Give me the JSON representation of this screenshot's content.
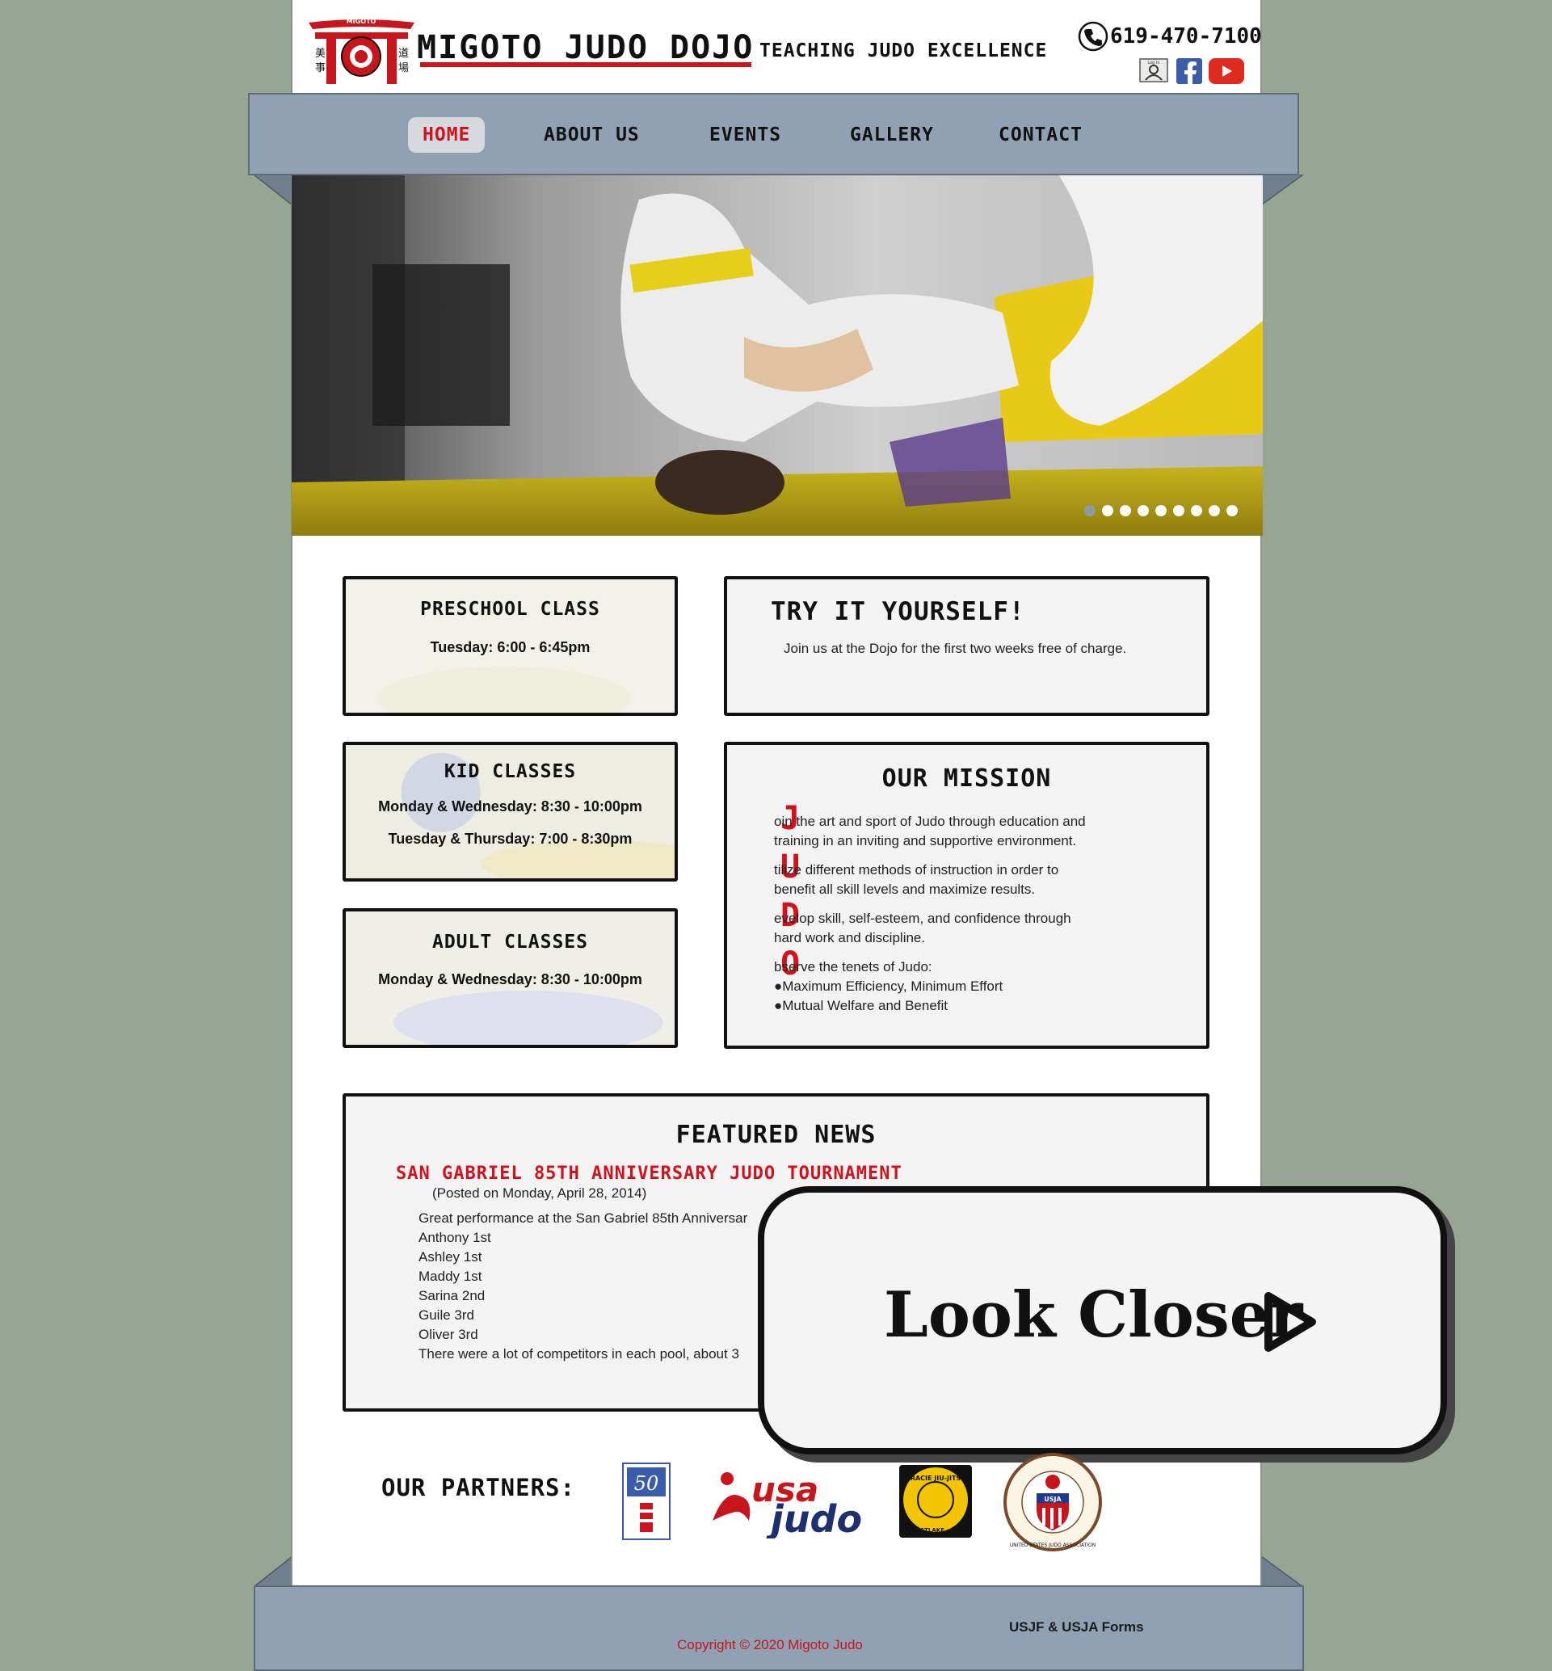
{
  "header": {
    "site_name": "Migoto Judo Dojo",
    "tagline": "Teaching Judo Excellence",
    "phone": "619-470-7100",
    "logo_text": "MIGOTO",
    "login_label": "Log In"
  },
  "nav": {
    "items": [
      {
        "label": "HOME",
        "active": true
      },
      {
        "label": "ABOUT US",
        "active": false
      },
      {
        "label": "EVENTS",
        "active": false
      },
      {
        "label": "GALLERY",
        "active": false
      },
      {
        "label": "CONTACT",
        "active": false
      }
    ]
  },
  "slideshow": {
    "slide_count": 9,
    "current_slide": 1
  },
  "classes": {
    "preschool": {
      "title": "PRESCHOOL CLASS",
      "line1": "Tuesday: 6:00 - 6:45pm"
    },
    "kid": {
      "title": "KID CLASSES",
      "line1": "Monday & Wednesday: 8:30 - 10:00pm",
      "line2": "Tuesday & Thursday: 7:00 - 8:30pm"
    },
    "adult": {
      "title": "ADULT CLASSES",
      "line1": "Monday & Wednesday: 8:30 - 10:00pm"
    }
  },
  "try_it": {
    "title": "TRY IT YOURSELF!",
    "text": "Join us at the Dojo for the first two weeks free of charge."
  },
  "mission": {
    "title": "OUR MISSION",
    "rows": [
      {
        "letter": "J",
        "text1": "oin the art and sport of Judo through education and",
        "text2": "training in an inviting and supportive environment."
      },
      {
        "letter": "U",
        "text1": "tilize different methods of instruction in order to",
        "text2": "benefit all skill levels and maximize results."
      },
      {
        "letter": "D",
        "text1": "evelop skill, self-esteem, and confidence through",
        "text2": "hard work and discipline."
      },
      {
        "letter": "O",
        "text1": "bserve the tenets of Judo:",
        "text2": "●Maximum Efficiency, Minimum Effort",
        "text3": "●Mutual Welfare and Benefit"
      }
    ]
  },
  "news": {
    "title": "FEATURED NEWS",
    "headline": "SAN GABRIEL 85TH ANNIVERSARY JUDO TOURNAMENT",
    "posted": "(Posted on Monday, April 28, 2014)",
    "intro": "Great performance at the San Gabriel 85th Anniversar",
    "results": [
      "Anthony 1st",
      "Ashley 1st",
      "Maddy 1st",
      "Sarina 2nd",
      "Guile 3rd",
      "Oliver 3rd"
    ],
    "outro": "There were a lot of competitors in each pool, about 3"
  },
  "overlay": {
    "label": "Look Closer"
  },
  "partners": {
    "label": "OUR PARTNERS:",
    "usa_judo_top": "usa",
    "usa_judo_bottom": "judo",
    "gracie_text": "GRACIE JIU-JITSU",
    "gracie_sub": "EASTLAKE · CA",
    "usja_text": "UNITED STATES JUDO ASSOCIATION",
    "usja_center": "USJA"
  },
  "footer": {
    "forms_link": "USJF & USJA Forms",
    "copyright": "Copyright © 2020 Migoto Judo"
  },
  "colors": {
    "background": "#96a692",
    "ribbon": "#8fa1b2",
    "accent_red": "#d1111b",
    "card_bg": "#f3f3f3"
  }
}
